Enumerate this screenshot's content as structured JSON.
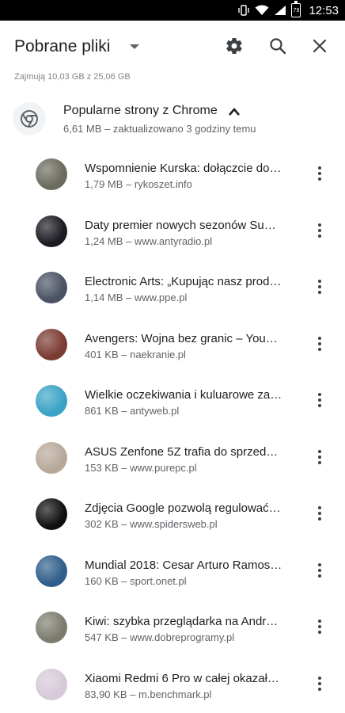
{
  "status_bar": {
    "time": "12:53",
    "battery_level": "79",
    "icons": [
      "vibrate-icon",
      "wifi-icon",
      "cell-signal-icon",
      "battery-icon"
    ]
  },
  "app_bar": {
    "title": "Pobrane pliki",
    "icons": [
      "dropdown-icon",
      "settings-gear-icon",
      "search-icon",
      "close-icon"
    ]
  },
  "storage_text": "Zajmują 10,03 GB z 25,06 GB",
  "group": {
    "title": "Popularne strony z Chrome",
    "subtitle": "6,61 MB – zaktualizowano 3 godziny temu",
    "icon": "chrome-icon"
  },
  "items": [
    {
      "title": "Wspomnienie Kurska: dołączcie do…",
      "meta": "1,79 MB – rykoszet.info",
      "thumb_color": "#6b6a5e"
    },
    {
      "title": "Daty premier nowych sezonów Sup…",
      "meta": "1,24 MB – www.antyradio.pl",
      "thumb_color": "#1d1b22"
    },
    {
      "title": "Electronic Arts: „Kupując nasz prod…",
      "meta": "1,14 MB – www.ppe.pl",
      "thumb_color": "#4a5263"
    },
    {
      "title": "Avengers: Wojna bez granic – You…",
      "meta": "401 KB – naekranie.pl",
      "thumb_color": "#7a3b33"
    },
    {
      "title": "Wielkie oczekiwania i kuluarowe za…",
      "meta": "861 KB – antyweb.pl",
      "thumb_color": "#3aa3c5"
    },
    {
      "title": "ASUS Zenfone 5Z trafia do sprzeda…",
      "meta": "153 KB – www.purepc.pl",
      "thumb_color": "#b8a89a"
    },
    {
      "title": "Zdjęcia Google pozwolą regulować…",
      "meta": "302 KB – www.spidersweb.pl",
      "thumb_color": "#101010"
    },
    {
      "title": "Mundial 2018: Cesar Arturo Ramos…",
      "meta": "160 KB – sport.onet.pl",
      "thumb_color": "#2f5e8a"
    },
    {
      "title": "Kiwi: szybka przeglądarka na Andr…",
      "meta": "547 KB – www.dobreprogramy.pl",
      "thumb_color": "#7c7c6e"
    },
    {
      "title": "Xiaomi Redmi 6 Pro w całej okazał…",
      "meta": "83,90 KB – m.benchmark.pl",
      "thumb_color": "#d6c9d8"
    }
  ]
}
